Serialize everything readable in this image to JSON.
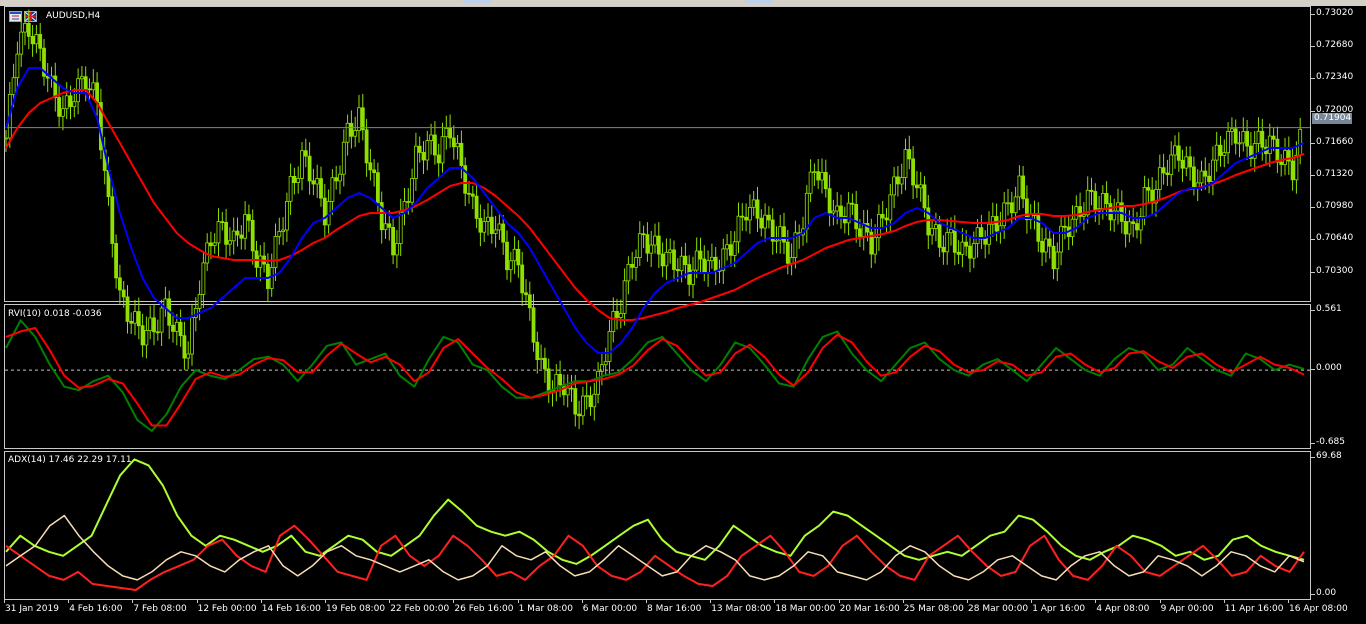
{
  "chart": {
    "symbol_title": "AUDUSD,H4",
    "current_price": "0.71904",
    "price_axis": [
      "0.73020",
      "0.72680",
      "0.72340",
      "0.72000",
      "0.71660",
      "0.71320",
      "0.70980",
      "0.70640",
      "0.70300"
    ],
    "rvi_label": "RVI(10) 0.018 -0.036",
    "rvi_axis": [
      "0.561",
      "0.000",
      "-0.685"
    ],
    "adx_label": "ADX(14) 17.46 22.29 17.11",
    "adx_axis": [
      "69.68",
      "0.00"
    ],
    "dates": [
      "31 Jan 2019",
      "4 Feb 16:00",
      "7 Feb 08:00",
      "12 Feb 00:00",
      "14 Feb 16:00",
      "19 Feb 08:00",
      "22 Feb 00:00",
      "26 Feb 16:00",
      "1 Mar 08:00",
      "6 Mar 00:00",
      "8 Mar 16:00",
      "13 Mar 08:00",
      "18 Mar 00:00",
      "20 Mar 16:00",
      "25 Mar 08:00",
      "28 Mar 00:00",
      "1 Apr 16:00",
      "4 Apr 08:00",
      "9 Apr 00:00",
      "11 Apr 16:00",
      "16 Apr 08:00"
    ],
    "colors": {
      "candles": "#8fe000",
      "ma_fast": "#0000ff",
      "ma_slow": "#ff0000",
      "rvi_main": "#008000",
      "rvi_signal": "#ff0000",
      "adx_main": "#adff2f",
      "adx_plus": "#ff2020",
      "adx_minus": "#f5deb3",
      "grid": "#c8c8c8"
    }
  },
  "chart_data": [
    {
      "type": "line",
      "title": "AUDUSD,H4",
      "description_series": "price",
      "ylim": [
        0.702,
        0.731
      ],
      "series": [
        {
          "name": "price",
          "values": [
            0.718,
            0.7275,
            0.729,
            0.7265,
            0.723,
            0.7205,
            0.7225,
            0.724,
            0.7215,
            0.711,
            0.702,
            0.7,
            0.6985,
            0.699,
            0.701,
            0.6985,
            0.6965,
            0.7035,
            0.708,
            0.709,
            0.7075,
            0.71,
            0.706,
            0.704,
            0.7085,
            0.713,
            0.716,
            0.714,
            0.7105,
            0.714,
            0.7185,
            0.72,
            0.715,
            0.71,
            0.707,
            0.711,
            0.716,
            0.7175,
            0.7165,
            0.719,
            0.715,
            0.711,
            0.709,
            0.7095,
            0.706,
            0.7055,
            0.7,
            0.695,
            0.693,
            0.6935,
            0.691,
            0.6915,
            0.6935,
            0.6985,
            0.7015,
            0.706,
            0.708,
            0.707,
            0.706,
            0.7055,
            0.7045,
            0.706,
            0.705,
            0.706,
            0.708,
            0.711,
            0.7105,
            0.709,
            0.708,
            0.706,
            0.71,
            0.7155,
            0.7125,
            0.71,
            0.711,
            0.709,
            0.7075,
            0.71,
            0.713,
            0.716,
            0.7135,
            0.7095,
            0.7075,
            0.708,
            0.7065,
            0.7075,
            0.7085,
            0.7095,
            0.711,
            0.713,
            0.71,
            0.7075,
            0.706,
            0.709,
            0.71,
            0.712,
            0.7115,
            0.711,
            0.71,
            0.7085,
            0.712,
            0.713,
            0.7155,
            0.7165,
            0.7145,
            0.7135,
            0.7155,
            0.7175,
            0.7185,
            0.717,
            0.7175,
            0.7175,
            0.716,
            0.715,
            0.719
          ]
        },
        {
          "name": "ma_fast",
          "values": [
            0.719,
            0.723,
            0.725,
            0.725,
            0.724,
            0.723,
            0.7225,
            0.7225,
            0.72,
            0.715,
            0.7105,
            0.707,
            0.704,
            0.702,
            0.701,
            0.7,
            0.7,
            0.7005,
            0.701,
            0.702,
            0.703,
            0.704,
            0.704,
            0.704,
            0.7045,
            0.706,
            0.708,
            0.7095,
            0.71,
            0.711,
            0.712,
            0.7125,
            0.712,
            0.711,
            0.71,
            0.7105,
            0.7115,
            0.713,
            0.714,
            0.715,
            0.715,
            0.714,
            0.7125,
            0.711,
            0.7095,
            0.7085,
            0.707,
            0.705,
            0.703,
            0.701,
            0.699,
            0.6975,
            0.6965,
            0.6965,
            0.6975,
            0.699,
            0.701,
            0.7025,
            0.7035,
            0.704,
            0.7045,
            0.7045,
            0.7045,
            0.705,
            0.7055,
            0.7065,
            0.7075,
            0.708,
            0.708,
            0.708,
            0.7085,
            0.71,
            0.7105,
            0.71,
            0.71,
            0.7095,
            0.709,
            0.709,
            0.7095,
            0.7105,
            0.711,
            0.7105,
            0.7095,
            0.709,
            0.7085,
            0.708,
            0.708,
            0.7085,
            0.709,
            0.71,
            0.71,
            0.7095,
            0.7085,
            0.7085,
            0.709,
            0.71,
            0.7105,
            0.7105,
            0.7105,
            0.71,
            0.71,
            0.7105,
            0.7115,
            0.7125,
            0.713,
            0.713,
            0.7135,
            0.7145,
            0.7155,
            0.716,
            0.7165,
            0.717,
            0.717,
            0.717,
            0.7175
          ]
        },
        {
          "name": "ma_slow",
          "values": [
            0.717,
            0.719,
            0.7205,
            0.7215,
            0.722,
            0.7225,
            0.7228,
            0.7228,
            0.7215,
            0.7195,
            0.7175,
            0.7155,
            0.7135,
            0.7115,
            0.71,
            0.7085,
            0.7075,
            0.7068,
            0.7062,
            0.706,
            0.7058,
            0.7058,
            0.7058,
            0.7057,
            0.7058,
            0.7062,
            0.7068,
            0.7075,
            0.708,
            0.7088,
            0.7095,
            0.7102,
            0.7105,
            0.7105,
            0.7105,
            0.7108,
            0.7112,
            0.7118,
            0.7125,
            0.7132,
            0.7135,
            0.7135,
            0.713,
            0.7122,
            0.7112,
            0.7102,
            0.709,
            0.7075,
            0.706,
            0.7045,
            0.703,
            0.7018,
            0.7008,
            0.7,
            0.6998,
            0.6998,
            0.7,
            0.7003,
            0.7006,
            0.701,
            0.7013,
            0.7016,
            0.702,
            0.7024,
            0.7028,
            0.7034,
            0.704,
            0.7045,
            0.705,
            0.7054,
            0.7058,
            0.7064,
            0.707,
            0.7074,
            0.7078,
            0.708,
            0.7082,
            0.7084,
            0.7087,
            0.7092,
            0.7096,
            0.7098,
            0.7098,
            0.7097,
            0.7096,
            0.7095,
            0.7095,
            0.7096,
            0.7098,
            0.7102,
            0.7104,
            0.7104,
            0.7102,
            0.7102,
            0.7103,
            0.7106,
            0.7108,
            0.711,
            0.7112,
            0.7112,
            0.7114,
            0.7117,
            0.7121,
            0.7126,
            0.7129,
            0.7131,
            0.7134,
            0.7138,
            0.7143,
            0.7147,
            0.7151,
            0.7155,
            0.7158,
            0.716,
            0.7164
          ]
        }
      ]
    },
    {
      "type": "line",
      "title": "RVI(10) 0.018 -0.036",
      "ylim": [
        -0.685,
        0.561
      ],
      "series": [
        {
          "name": "rvi_main",
          "values": [
            0.2,
            0.45,
            0.3,
            0.05,
            -0.15,
            -0.18,
            -0.1,
            -0.05,
            -0.2,
            -0.45,
            -0.55,
            -0.4,
            -0.15,
            0.0,
            -0.05,
            -0.08,
            0.0,
            0.1,
            0.12,
            0.05,
            -0.1,
            0.05,
            0.22,
            0.25,
            0.05,
            0.1,
            0.15,
            -0.05,
            -0.15,
            0.1,
            0.3,
            0.25,
            0.05,
            0.0,
            -0.15,
            -0.25,
            -0.25,
            -0.2,
            -0.15,
            -0.1,
            -0.1,
            -0.05,
            -0.02,
            0.1,
            0.25,
            0.3,
            0.15,
            0.0,
            -0.1,
            0.05,
            0.25,
            0.2,
            0.05,
            -0.12,
            -0.15,
            0.1,
            0.3,
            0.35,
            0.15,
            0.0,
            -0.1,
            0.05,
            0.2,
            0.25,
            0.1,
            0.0,
            -0.05,
            0.05,
            0.1,
            0.0,
            -0.1,
            0.05,
            0.2,
            0.1,
            0.0,
            -0.05,
            0.1,
            0.2,
            0.15,
            0.0,
            0.05,
            0.2,
            0.1,
            0.0,
            -0.05,
            0.15,
            0.1,
            0.0,
            0.05,
            0.01
          ]
        },
        {
          "name": "rvi_signal",
          "values": [
            0.3,
            0.35,
            0.38,
            0.18,
            -0.05,
            -0.16,
            -0.14,
            -0.08,
            -0.12,
            -0.3,
            -0.5,
            -0.5,
            -0.3,
            -0.08,
            -0.02,
            -0.06,
            -0.04,
            0.05,
            0.11,
            0.09,
            -0.02,
            -0.02,
            0.13,
            0.24,
            0.15,
            0.07,
            0.12,
            0.05,
            -0.1,
            -0.02,
            0.2,
            0.28,
            0.15,
            0.02,
            -0.08,
            -0.2,
            -0.25,
            -0.22,
            -0.18,
            -0.12,
            -0.1,
            -0.08,
            -0.04,
            0.04,
            0.18,
            0.28,
            0.22,
            0.08,
            -0.05,
            -0.02,
            0.15,
            0.23,
            0.12,
            -0.04,
            -0.14,
            -0.02,
            0.2,
            0.32,
            0.25,
            0.08,
            -0.05,
            -0.02,
            0.12,
            0.22,
            0.17,
            0.05,
            -0.02,
            0.0,
            0.08,
            0.05,
            -0.05,
            -0.02,
            0.12,
            0.15,
            0.05,
            -0.02,
            0.02,
            0.15,
            0.17,
            0.08,
            0.02,
            0.12,
            0.15,
            0.05,
            -0.02,
            0.05,
            0.12,
            0.05,
            0.02,
            -0.04
          ]
        }
      ]
    },
    {
      "type": "line",
      "title": "ADX(14) 17.46 22.29 17.11",
      "ylim": [
        0,
        69.68
      ],
      "series": [
        {
          "name": "adx_main",
          "values": [
            22,
            30,
            25,
            22,
            20,
            25,
            30,
            45,
            60,
            68,
            65,
            55,
            40,
            30,
            25,
            30,
            28,
            25,
            22,
            25,
            30,
            22,
            20,
            25,
            30,
            28,
            22,
            20,
            25,
            30,
            40,
            48,
            42,
            35,
            32,
            30,
            32,
            28,
            22,
            18,
            16,
            20,
            25,
            30,
            35,
            38,
            28,
            22,
            20,
            18,
            25,
            35,
            30,
            25,
            22,
            20,
            30,
            35,
            42,
            40,
            35,
            30,
            25,
            20,
            18,
            20,
            22,
            20,
            25,
            30,
            32,
            40,
            38,
            32,
            25,
            20,
            18,
            22,
            25,
            30,
            28,
            25,
            20,
            22,
            18,
            20,
            28,
            30,
            25,
            22,
            20,
            18
          ]
        },
        {
          "name": "adx_plus",
          "values": [
            25,
            20,
            15,
            10,
            8,
            12,
            6,
            5,
            4,
            3,
            8,
            12,
            15,
            18,
            25,
            28,
            20,
            15,
            12,
            30,
            35,
            28,
            20,
            12,
            10,
            8,
            25,
            30,
            20,
            15,
            20,
            30,
            25,
            18,
            10,
            12,
            8,
            15,
            20,
            30,
            25,
            15,
            10,
            8,
            12,
            20,
            15,
            10,
            6,
            5,
            10,
            20,
            25,
            30,
            22,
            12,
            10,
            15,
            25,
            30,
            22,
            15,
            10,
            8,
            20,
            25,
            30,
            22,
            15,
            10,
            12,
            25,
            30,
            18,
            10,
            8,
            15,
            25,
            20,
            12,
            10,
            15,
            20,
            25,
            18,
            10,
            12,
            20,
            15,
            12,
            22
          ]
        },
        {
          "name": "adx_minus",
          "values": [
            15,
            20,
            25,
            35,
            40,
            30,
            22,
            15,
            10,
            8,
            12,
            18,
            22,
            20,
            15,
            12,
            18,
            22,
            25,
            15,
            10,
            15,
            22,
            25,
            20,
            18,
            15,
            12,
            15,
            18,
            12,
            8,
            10,
            15,
            25,
            20,
            18,
            22,
            15,
            10,
            12,
            18,
            25,
            20,
            15,
            10,
            12,
            20,
            25,
            22,
            18,
            10,
            8,
            10,
            15,
            22,
            20,
            12,
            10,
            8,
            12,
            20,
            25,
            22,
            15,
            10,
            8,
            12,
            18,
            20,
            15,
            10,
            8,
            15,
            20,
            22,
            15,
            10,
            12,
            20,
            18,
            15,
            10,
            15,
            22,
            20,
            15,
            12,
            20,
            17
          ]
        }
      ]
    }
  ]
}
